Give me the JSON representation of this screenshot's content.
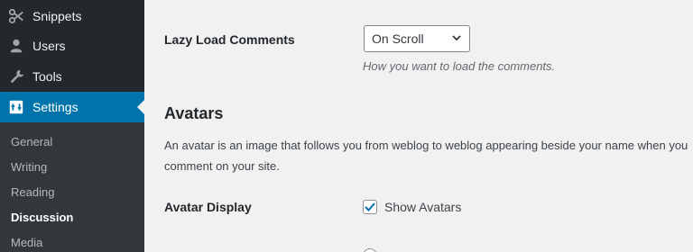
{
  "sidebar": {
    "items": [
      {
        "label": "Snippets",
        "icon": "scissors-icon"
      },
      {
        "label": "Users",
        "icon": "users-icon"
      },
      {
        "label": "Tools",
        "icon": "wrench-icon"
      },
      {
        "label": "Settings",
        "icon": "settings-icon",
        "active": true
      }
    ],
    "submenu": [
      {
        "label": "General"
      },
      {
        "label": "Writing"
      },
      {
        "label": "Reading"
      },
      {
        "label": "Discussion",
        "current": true
      },
      {
        "label": "Media"
      }
    ]
  },
  "main": {
    "lazy_load": {
      "label": "Lazy Load Comments",
      "selected": "On Scroll",
      "description": "How you want to load the comments."
    },
    "avatars": {
      "title": "Avatars",
      "description": "An avatar is an image that follows you from weblog to weblog appearing beside your name when you comment on your site."
    },
    "avatar_display": {
      "label": "Avatar Display",
      "checkbox_label": "Show Avatars",
      "checked": true
    }
  },
  "colors": {
    "sidebar_bg": "#23282d",
    "submenu_bg": "#32373c",
    "accent": "#0073aa",
    "content_bg": "#f1f1f1"
  }
}
